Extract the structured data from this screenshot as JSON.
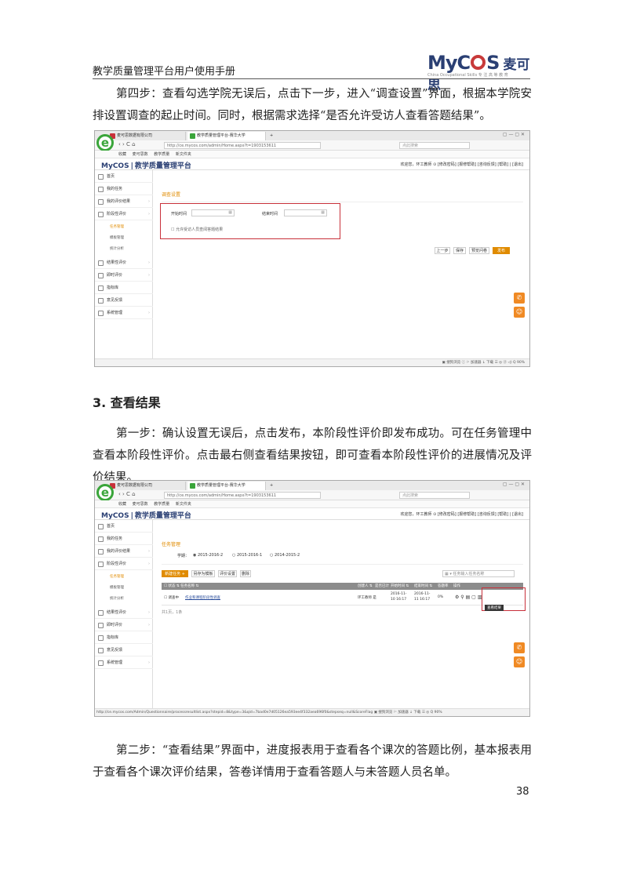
{
  "header": {
    "title": "教学质量管理平台用户使用手册",
    "logo_text_1": "My",
    "logo_text_2": "S",
    "logo_cn": "麦可思",
    "logo_sub": "China Occupational Skills  专 注 高 等 教 育",
    "logo_c": "C"
  },
  "paragraphs": {
    "p1": "第四步：查看勾选学院无误后，点击下一步，进入“调查设置”界面，根据本学院安排设置调查的起止时间。同时，根据需求选择“是否允许受访人查看答题结果”。",
    "section_heading": "3.  查看结果",
    "p2": "第一步：确认设置无误后，点击发布，本阶段性评价即发布成功。可在任务管理中查看本阶段性评价。点击最右侧查看结果按钮，即可查看本阶段性评价的进展情况及评价结果。",
    "p3": "第二步：“查看结果”界面中，进度报表用于查看各个课次的答题比例，基本报表用于查看各个课次评价结果，答卷详情用于查看答题人与未答题人员名单。"
  },
  "page_number": "38",
  "browser": {
    "tab1": "麦可思数据有限公司",
    "tab2": "教学质量管理平台-赛华大学",
    "tab_add": "+",
    "url": "http://ce.mycos.com/admin/Home.aspx?t=1903153611",
    "search_placeholder": "点此搜索",
    "bookmarks": [
      "收藏",
      "麦可思数",
      "教学质量",
      "新文件夹"
    ],
    "win_controls": "▢ — ▢ ✕",
    "nav": "‹  ›  C  ⌂"
  },
  "app": {
    "logo_brand": "MyCOS",
    "logo_sep": "|",
    "logo_name": "教学质量管理平台",
    "user_bar": "欢迎您，环工教师 ⊙   [修改密码] [报修帮助] [咨询反馈] [帮助] | [退出]",
    "sidebar": [
      {
        "label": "首页",
        "icon": "home-icon"
      },
      {
        "label": "我的任务",
        "icon": "user-icon"
      },
      {
        "label": "我的评价结果",
        "icon": "grid-icon"
      },
      {
        "label": "阶段性评价",
        "icon": "flag-icon"
      },
      {
        "label": "结果性评价",
        "icon": "clock-icon"
      },
      {
        "label": "即时评价",
        "icon": "doc-icon"
      },
      {
        "label": "指标库",
        "icon": "chart-icon"
      },
      {
        "label": "意见反馈",
        "icon": "mail-icon"
      },
      {
        "label": "系统管理",
        "icon": "gear-icon"
      }
    ],
    "subitems": [
      "任务管理",
      "模板管理",
      "统计分析"
    ],
    "chevron": "›"
  },
  "shot1": {
    "panel_title": "调查设置",
    "start_label": "开始时间",
    "end_label": "结束时间",
    "allow_check": "☐ 允许受访人员查阅答题结果",
    "btn_prev": "上一步",
    "btn_save": "保存",
    "btn_preview": "预览问卷",
    "btn_publish": "发布",
    "status": "▣ 搜狗浏览 ⓘ  ⚐ 加速器  ↓ 下载  ☰  ◎  ⓓ  ◁)  Q 90%"
  },
  "shot2": {
    "panel_title": "任务管理",
    "year_label": "学期：",
    "radios": [
      "◉ 2015-2016-2",
      "○ 2015-2016-1",
      "○ 2014-2015-2"
    ],
    "btn_new": "新建任务 +",
    "btn_template": "另存为模板",
    "btn_settings": "评价设置",
    "btn_delete": "删除",
    "search_placeholder": "▦ ▾ 任务输入任务名称",
    "columns": [
      "☐ 状态 ⇅  任务名称 ⇅",
      "创建人 ⇅",
      "是否已计",
      "开始时间 ⇅",
      "结束时间 ⇅",
      "答题率",
      "操作"
    ],
    "row": {
      "status": "☐ 调查中",
      "name": "作业和课程阶段性调查",
      "creator": "环工教师 是",
      "start": "2016-11-10 16:17",
      "end": "2016-11-11 16:17",
      "rate": "0%",
      "ops": "⚙   ⚲ ▤ ▢ ▥"
    },
    "pager": "共1页，1条",
    "tooltip": "查看结果",
    "status": "http://ce.mycos.com/Admin/Questionnaire/processresultlist.aspx?stepid=8&type=3&qid=7bad0e7d05126ea593ee4f332aea696f0&stepseq=null&ScoreFlag  ▣ 搜狗浏览  ⚐ 加速器  ↓ 下载  ☰  ◎  Q 90%"
  }
}
